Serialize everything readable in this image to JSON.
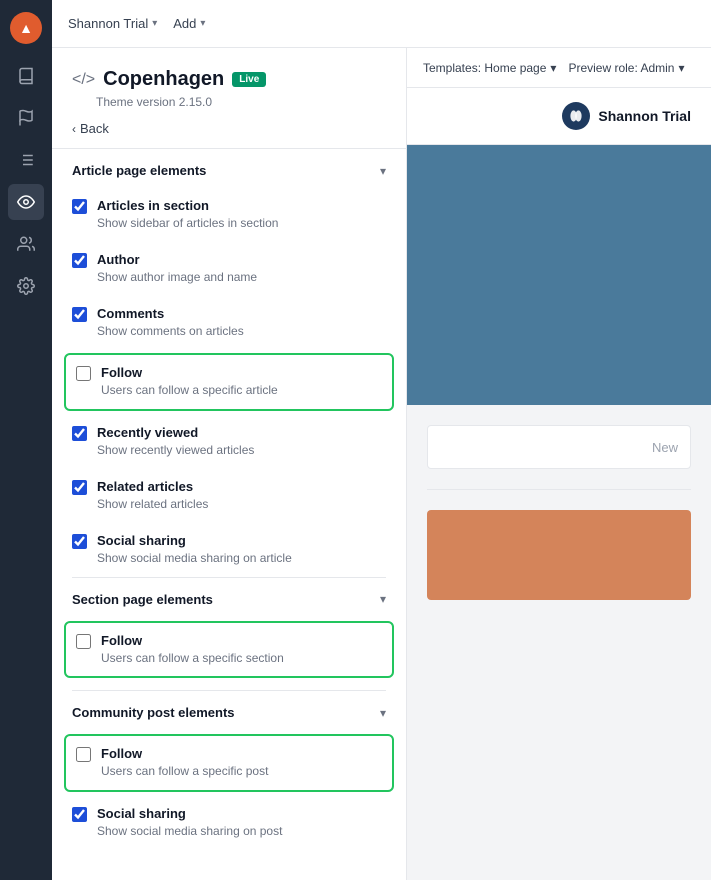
{
  "nav": {
    "logo": "▲",
    "icons": [
      {
        "name": "book-icon",
        "symbol": "📖",
        "active": false
      },
      {
        "name": "flag-icon",
        "symbol": "⚑",
        "active": false
      },
      {
        "name": "list-icon",
        "symbol": "☰",
        "active": false
      },
      {
        "name": "eye-icon",
        "symbol": "👁",
        "active": true
      },
      {
        "name": "users-icon",
        "symbol": "👥",
        "active": false
      },
      {
        "name": "gear-icon",
        "symbol": "⚙",
        "active": false
      }
    ]
  },
  "topbar": {
    "brand": "Shannon Trial",
    "brand_chevron": "▾",
    "add_label": "Add",
    "add_chevron": "▾"
  },
  "sidebar": {
    "theme_icon": "</>",
    "theme_name": "Copenhagen",
    "live_badge": "Live",
    "theme_version": "Theme version 2.15.0",
    "back_label": "Back",
    "article_section_title": "Article page elements",
    "article_items": [
      {
        "id": "articles-in-section",
        "label": "Articles in section",
        "desc": "Show sidebar of articles in section",
        "checked": true,
        "highlighted": false
      },
      {
        "id": "author",
        "label": "Author",
        "desc": "Show author image and name",
        "checked": true,
        "highlighted": false
      },
      {
        "id": "comments",
        "label": "Comments",
        "desc": "Show comments on articles",
        "checked": true,
        "highlighted": false
      },
      {
        "id": "follow-article",
        "label": "Follow",
        "desc": "Users can follow a specific article",
        "checked": false,
        "highlighted": true
      },
      {
        "id": "recently-viewed",
        "label": "Recently viewed",
        "desc": "Show recently viewed articles",
        "checked": true,
        "highlighted": false
      },
      {
        "id": "related-articles",
        "label": "Related articles",
        "desc": "Show related articles",
        "checked": true,
        "highlighted": false
      },
      {
        "id": "social-sharing-article",
        "label": "Social sharing",
        "desc": "Show social media sharing on article",
        "checked": true,
        "highlighted": false
      }
    ],
    "section_page_title": "Section page elements",
    "section_items": [
      {
        "id": "follow-section",
        "label": "Follow",
        "desc": "Users can follow a specific section",
        "checked": false,
        "highlighted": true
      }
    ],
    "community_post_title": "Community post elements",
    "community_items": [
      {
        "id": "follow-post",
        "label": "Follow",
        "desc": "Users can follow a specific post",
        "checked": false,
        "highlighted": true
      },
      {
        "id": "social-sharing-post",
        "label": "Social sharing",
        "desc": "Show social media sharing on post",
        "checked": true,
        "highlighted": false
      }
    ]
  },
  "preview": {
    "templates_label": "Templates: Home page",
    "templates_chevron": "▾",
    "preview_role_label": "Preview role: Admin",
    "preview_role_chevron": "▾",
    "brand_name": "Shannon Trial",
    "new_label": "New"
  }
}
